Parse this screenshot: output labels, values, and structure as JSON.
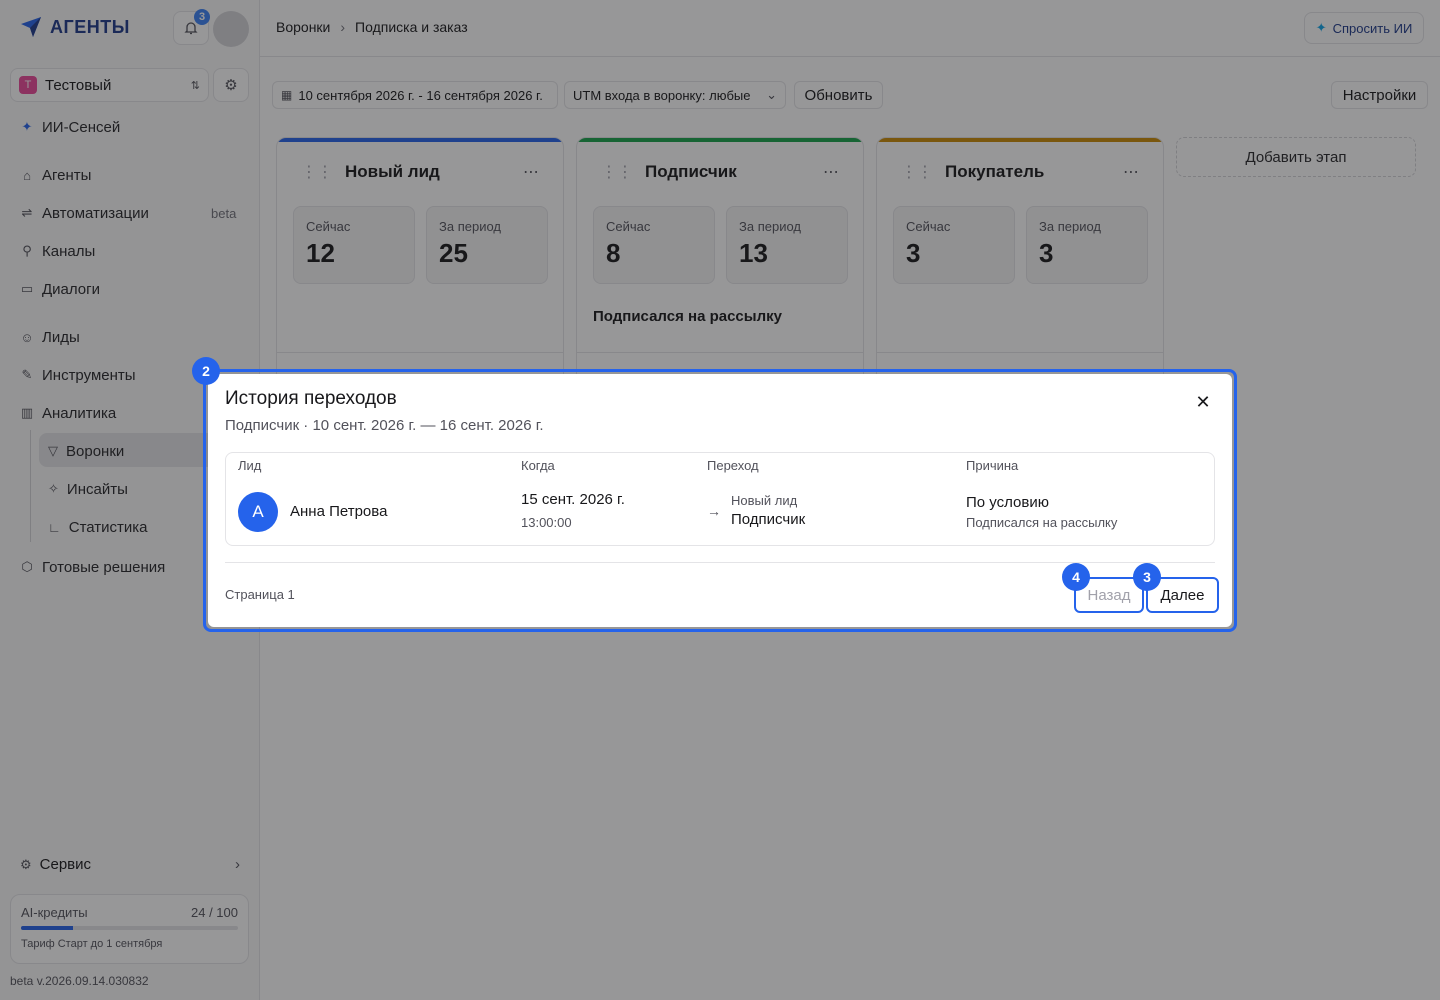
{
  "app": {
    "logo_text": "АГЕНТЫ",
    "notifications_count": "3"
  },
  "workspace": {
    "badge": "Т",
    "name": "Тестовый"
  },
  "sidebar": {
    "ai_sensei": "ИИ-Сенсей",
    "items": [
      {
        "label": "Агенты",
        "icon": "agents-icon"
      },
      {
        "label": "Автоматизации",
        "icon": "automation-icon",
        "tag": "beta"
      },
      {
        "label": "Каналы",
        "icon": "channels-icon"
      },
      {
        "label": "Диалоги",
        "icon": "dialogs-icon"
      },
      {
        "label": "Лиды",
        "icon": "leads-icon"
      },
      {
        "label": "Инструменты",
        "icon": "tools-icon"
      },
      {
        "label": "Аналитика",
        "icon": "analytics-icon"
      }
    ],
    "analytics_sub": [
      {
        "label": "Воронки",
        "icon": "funnel-icon"
      },
      {
        "label": "Инсайты",
        "icon": "insights-icon"
      },
      {
        "label": "Статистика",
        "icon": "stats-icon"
      }
    ],
    "ready_solutions": "Готовые решения",
    "service": "Сервис",
    "credits": {
      "label": "AI-кредиты",
      "value": "24 / 100",
      "fraction": 0.24,
      "plan": "Тариф Старт до 1 сентября"
    },
    "version": "beta v.2026.09.14.030832"
  },
  "header": {
    "breadcrumb": [
      "Воронки",
      "Подписка и заказ"
    ],
    "ask_ai": "Спросить ИИ"
  },
  "toolbar": {
    "date_range": "10 сентября 2026 г. - 16 сентября 2026 г.",
    "utm": "UTM входа в воронку: любые",
    "refresh": "Обновить",
    "settings": "Настройки"
  },
  "stages": [
    {
      "title": "Новый лид",
      "color": "#2563eb",
      "now_label": "Сейчас",
      "now": "12",
      "period_label": "За период",
      "period": "25",
      "note": ""
    },
    {
      "title": "Подписчик",
      "color": "#16a34a",
      "now_label": "Сейчас",
      "now": "8",
      "period_label": "За период",
      "period": "13",
      "note": "Подписался на рассылку"
    },
    {
      "title": "Покупатель",
      "color": "#ca8a04",
      "now_label": "Сейчас",
      "now": "3",
      "period_label": "За период",
      "period": "3",
      "note": ""
    }
  ],
  "add_stage": "Добавить этап",
  "modal": {
    "title": "История переходов",
    "subtitle": "Подписчик · 10 сент. 2026 г. — 16 сент. 2026 г.",
    "columns": [
      "Лид",
      "Когда",
      "Переход",
      "Причина"
    ],
    "row": {
      "avatar": "А",
      "name": "Анна Петрова",
      "date": "15 сент. 2026 г.",
      "time": "13:00:00",
      "from": "Новый лид",
      "to": "Подписчик",
      "reason": "По условию",
      "reason_detail": "Подписался на рассылку"
    },
    "page": "Страница 1",
    "back": "Назад",
    "next": "Далее"
  },
  "markers": [
    "2",
    "3",
    "4"
  ]
}
